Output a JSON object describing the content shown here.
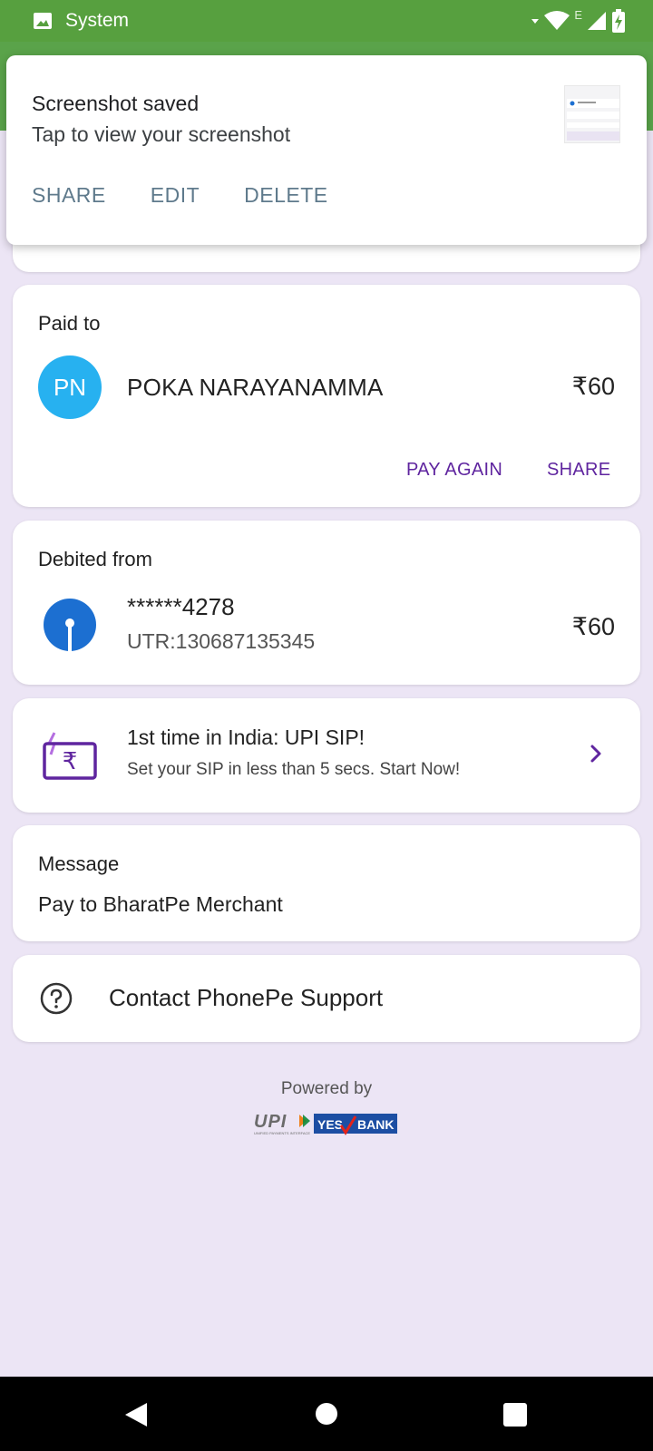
{
  "status_bar": {
    "label": "System",
    "icons": [
      "image-icon",
      "wifi-icon",
      "signal-icon",
      "battery-charging-icon"
    ],
    "network_type": "E"
  },
  "notification": {
    "title": "Screenshot saved",
    "text": "Tap to view your screenshot",
    "actions": [
      "SHARE",
      "EDIT",
      "DELETE"
    ]
  },
  "paid_to": {
    "label": "Paid to",
    "avatar_initials": "PN",
    "name": "POKA NARAYANAMMA",
    "amount": "₹60",
    "pay_again": "PAY AGAIN",
    "share": "SHARE"
  },
  "debited_from": {
    "label": "Debited from",
    "account": "******4278",
    "utr": "UTR:130687135345",
    "amount": "₹60"
  },
  "promo": {
    "title": "1st time in India: UPI SIP!",
    "subtitle": "Set your SIP in less than 5 secs. Start Now!"
  },
  "message": {
    "label": "Message",
    "text": "Pay to BharatPe Merchant"
  },
  "support": {
    "text": "Contact PhonePe Support"
  },
  "footer": {
    "powered_by": "Powered by",
    "logo_upi": "UPI",
    "logo_upi_tagline": "UNIFIED PAYMENTS INTERFACE",
    "logo_yes": "YES",
    "logo_bank": "BANK"
  },
  "colors": {
    "status_green": "#57a03f",
    "accent_purple": "#5f259f",
    "avatar_blue": "#27b1f0",
    "page_bg": "#ece5f5"
  }
}
